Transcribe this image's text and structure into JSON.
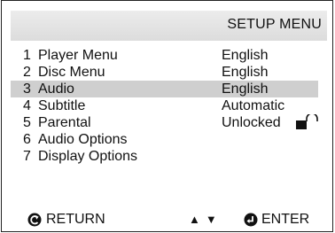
{
  "header": {
    "title": "SETUP  MENU"
  },
  "menu": {
    "items": [
      {
        "number": "1",
        "label": "Player Menu",
        "value": "English"
      },
      {
        "number": "2",
        "label": "Disc Menu",
        "value": "English"
      },
      {
        "number": "3",
        "label": "Audio",
        "value": "English",
        "selected": true
      },
      {
        "number": "4",
        "label": "Subtitle",
        "value": "Automatic"
      },
      {
        "number": "5",
        "label": "Parental",
        "value": "Unlocked",
        "icon": "unlocked-padlock-icon"
      },
      {
        "number": "6",
        "label": "Audio Options",
        "value": ""
      },
      {
        "number": "7",
        "label": "Display Options",
        "value": ""
      }
    ]
  },
  "footer": {
    "return_label": "RETURN",
    "return_icon": "return-arrow-icon",
    "nav_arrows": "▲▼",
    "nav_icon": "up-down-arrows-icon",
    "enter_label": "ENTER",
    "enter_icon": "enter-icon"
  },
  "colors": {
    "highlight": "#cfcfcf",
    "header_bg": "#e4e4e4",
    "text": "#111111"
  }
}
